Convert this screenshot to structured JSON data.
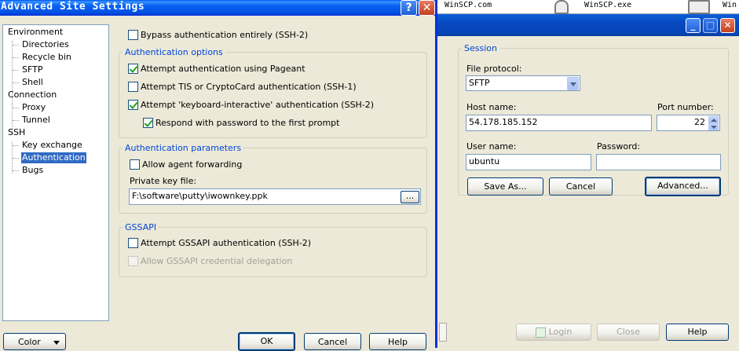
{
  "dialog": {
    "title": "Advanced Site Settings",
    "tree": [
      {
        "label": "Environment",
        "level": 0
      },
      {
        "label": "Directories",
        "level": 1
      },
      {
        "label": "Recycle bin",
        "level": 1
      },
      {
        "label": "SFTP",
        "level": 1
      },
      {
        "label": "Shell",
        "level": 1
      },
      {
        "label": "Connection",
        "level": 0
      },
      {
        "label": "Proxy",
        "level": 1
      },
      {
        "label": "Tunnel",
        "level": 1
      },
      {
        "label": "SSH",
        "level": 0
      },
      {
        "label": "Key exchange",
        "level": 1
      },
      {
        "label": "Authentication",
        "level": 1,
        "selected": true
      },
      {
        "label": "Bugs",
        "level": 1
      }
    ],
    "bypass_auth": {
      "label": "Bypass authentication entirely (SSH-2)",
      "checked": false
    },
    "auth_options": {
      "title": "Authentication options",
      "pageant": {
        "label": "Attempt authentication using Pageant",
        "checked": true
      },
      "tis": {
        "label": "Attempt TIS or CryptoCard authentication (SSH-1)",
        "checked": false
      },
      "keyboard_interactive": {
        "label": "Attempt 'keyboard-interactive' authentication (SSH-2)",
        "checked": true
      },
      "respond_password": {
        "label": "Respond with password to the first prompt",
        "checked": true
      }
    },
    "auth_params": {
      "title": "Authentication parameters",
      "agent_forwarding": {
        "label": "Allow agent forwarding",
        "checked": false
      },
      "private_key_label": "Private key file:",
      "private_key_value": "F:\\software\\putty\\iwownkey.ppk",
      "browse_label": "..."
    },
    "gssapi": {
      "title": "GSSAPI",
      "attempt": {
        "label": "Attempt GSSAPI authentication (SSH-2)",
        "checked": false
      },
      "delegation": {
        "label": "Allow GSSAPI credential delegation",
        "checked": false,
        "disabled": true
      }
    },
    "buttons": {
      "color": "Color",
      "ok": "OK",
      "cancel": "Cancel",
      "help": "Help"
    }
  },
  "login_window": {
    "taskstrip": [
      "WinSCP.com",
      "WinSCP.exe",
      "Win"
    ],
    "session": {
      "title": "Session",
      "file_protocol_label": "File protocol:",
      "file_protocol_value": "SFTP",
      "host_label": "Host name:",
      "host_value": "54.178.185.152",
      "port_label": "Port number:",
      "port_value": "22",
      "user_label": "User name:",
      "user_value": "ubuntu",
      "password_label": "Password:",
      "password_value": "",
      "save_as": "Save As...",
      "cancel": "Cancel",
      "advanced": "Advanced..."
    },
    "bottom": {
      "login": "Login",
      "close": "Close",
      "help": "Help"
    }
  }
}
